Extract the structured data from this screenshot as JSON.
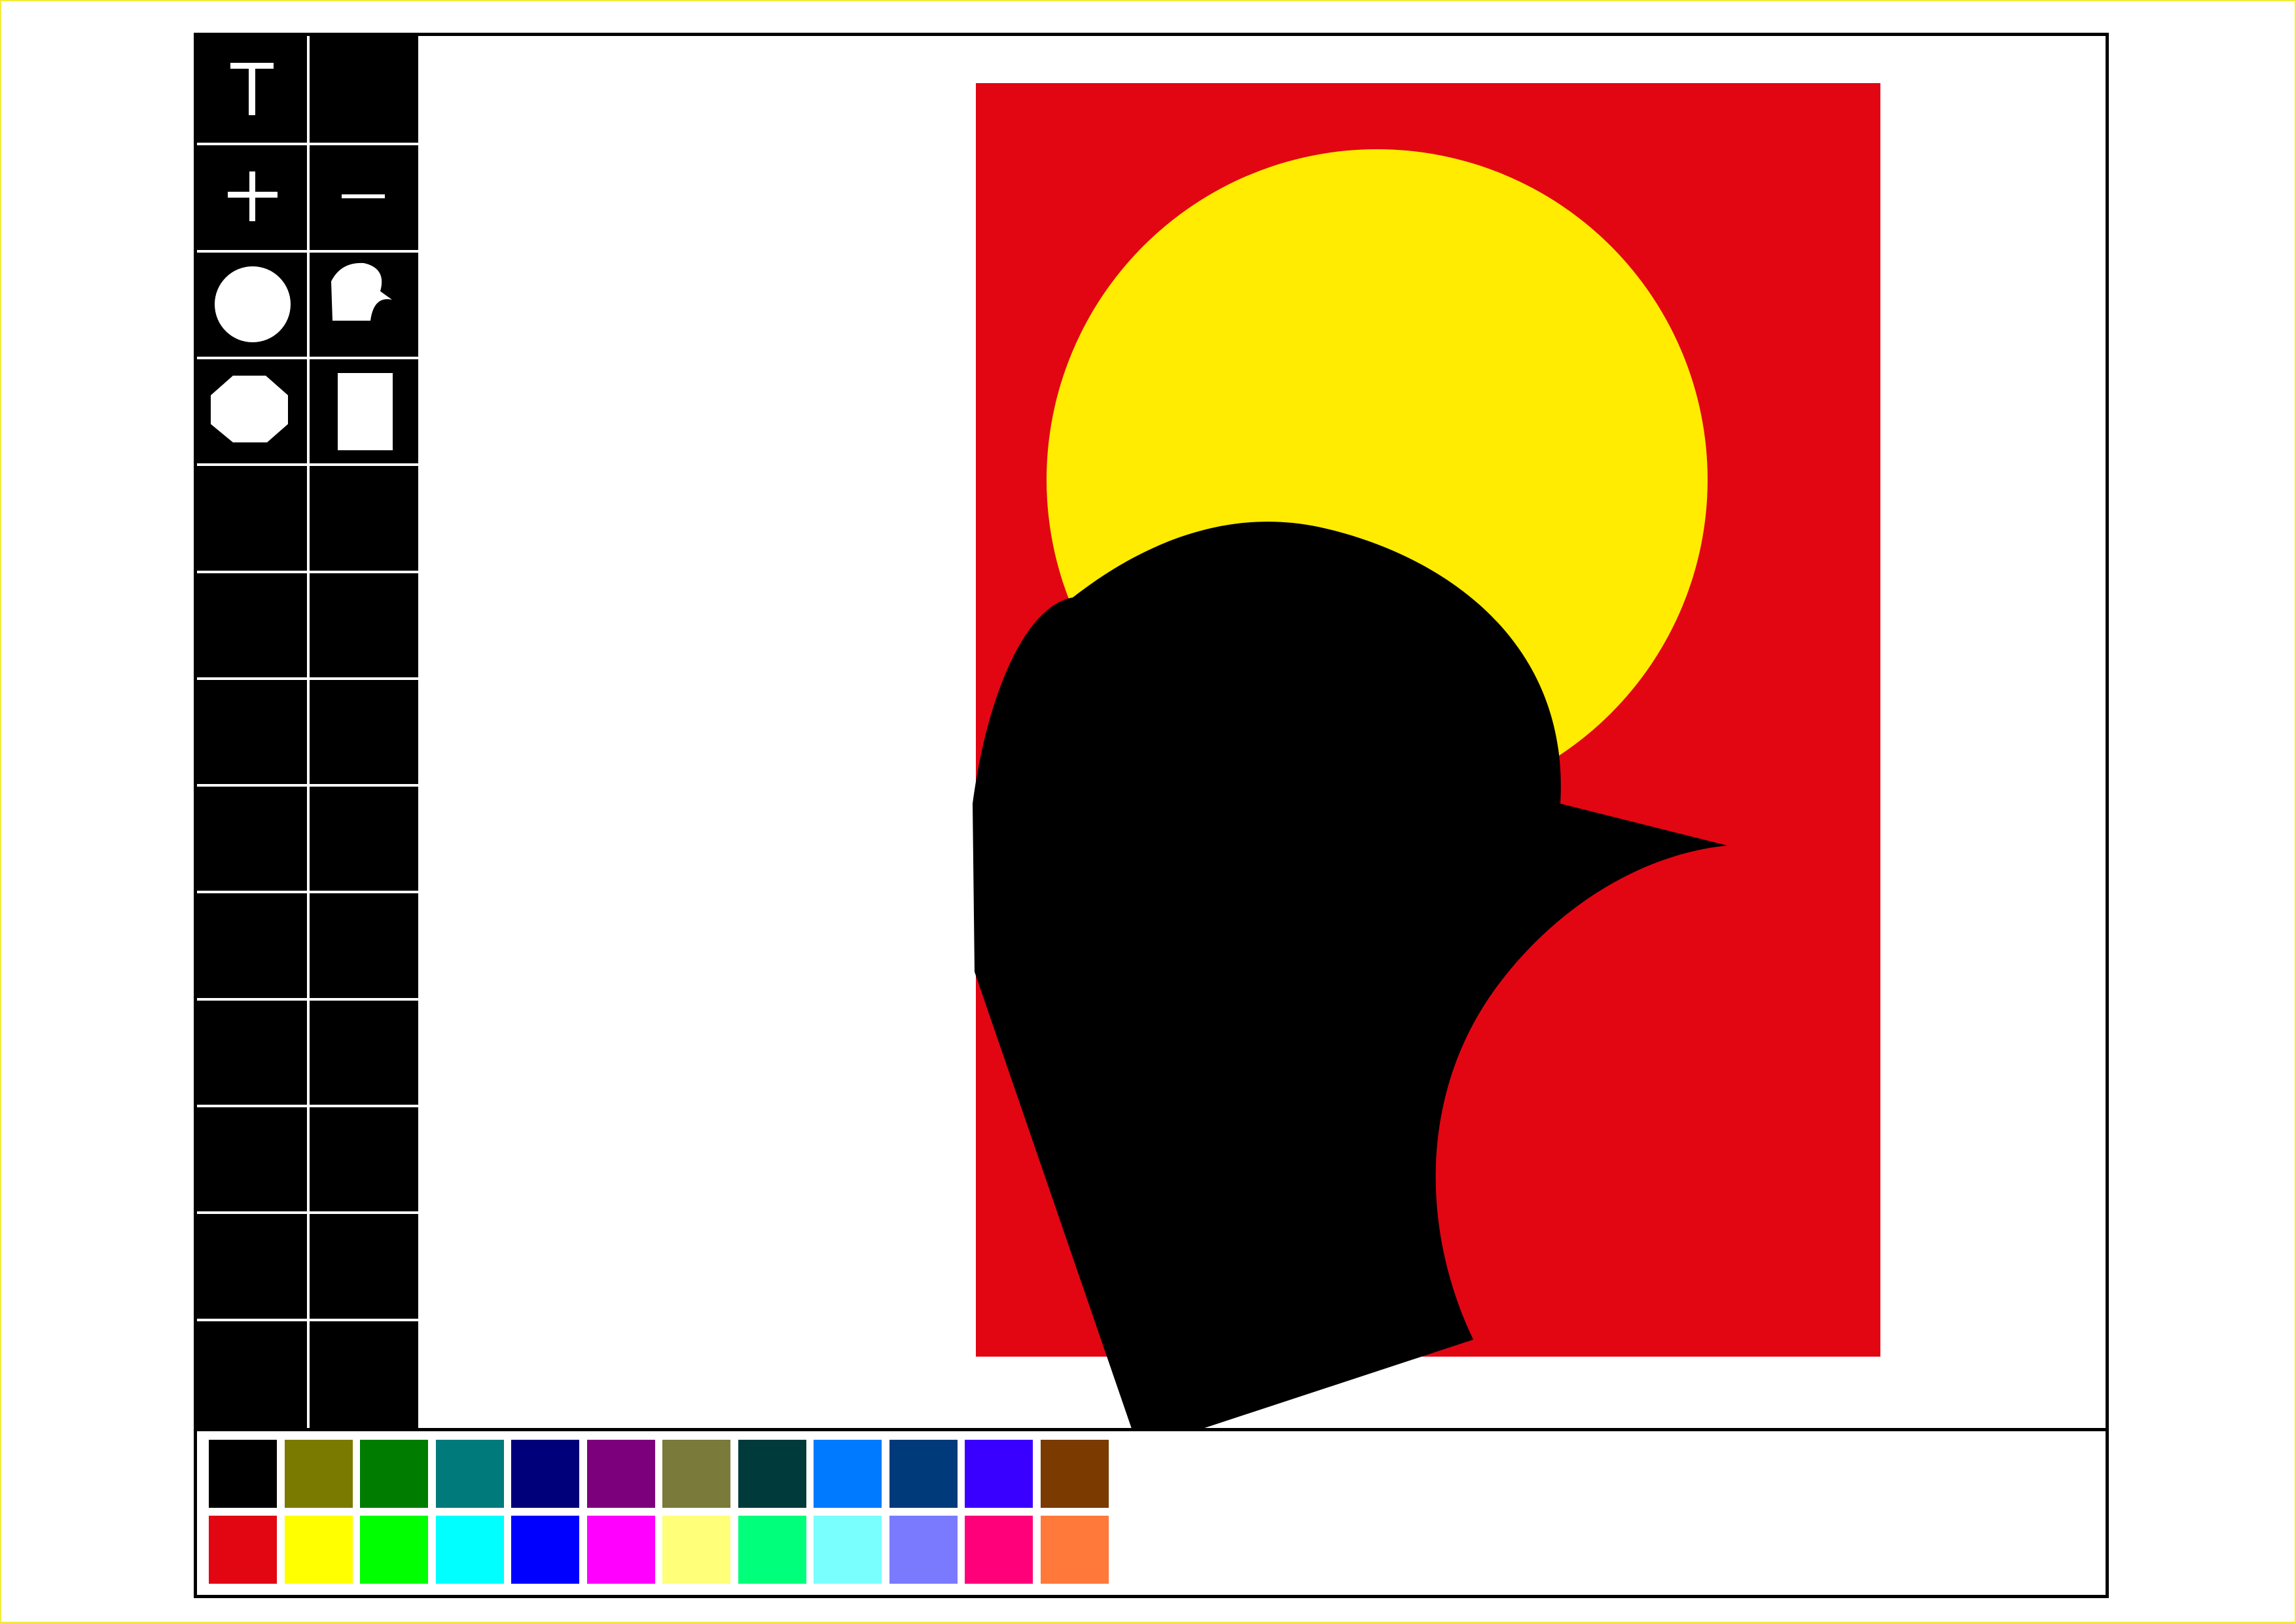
{
  "toolbox": {
    "tools": [
      {
        "name": "text-tool",
        "icon": "text-icon",
        "glyph": "T"
      },
      {
        "name": "empty-tool-slot",
        "icon": ""
      },
      {
        "name": "zoom-in-tool",
        "icon": "plus-icon",
        "glyph": "+"
      },
      {
        "name": "zoom-out-tool",
        "icon": "minus-icon",
        "glyph": "−"
      },
      {
        "name": "circle-tool",
        "icon": "circle-icon"
      },
      {
        "name": "freeform-tool",
        "icon": "freeform-shape-icon"
      },
      {
        "name": "polygon-tool",
        "icon": "octagon-icon"
      },
      {
        "name": "rectangle-tool",
        "icon": "rectangle-icon"
      }
    ]
  },
  "canvas": {
    "background_color": "#e20613",
    "sun_color": "#ffec00",
    "shape_color": "#000000"
  },
  "palette": {
    "row1": [
      "#000000",
      "#7a7a00",
      "#007c00",
      "#007a7a",
      "#00007a",
      "#7c007c",
      "#7a7a3a",
      "#003a3a",
      "#007aff",
      "#003a7a",
      "#3a00ff",
      "#7a3a00"
    ],
    "row2": [
      "#e20613",
      "#ffff00",
      "#00ff00",
      "#00ffff",
      "#0000ff",
      "#ff00ff",
      "#ffff7a",
      "#00ff7a",
      "#7affff",
      "#7a7aff",
      "#ff007a",
      "#ff7a3a"
    ]
  }
}
